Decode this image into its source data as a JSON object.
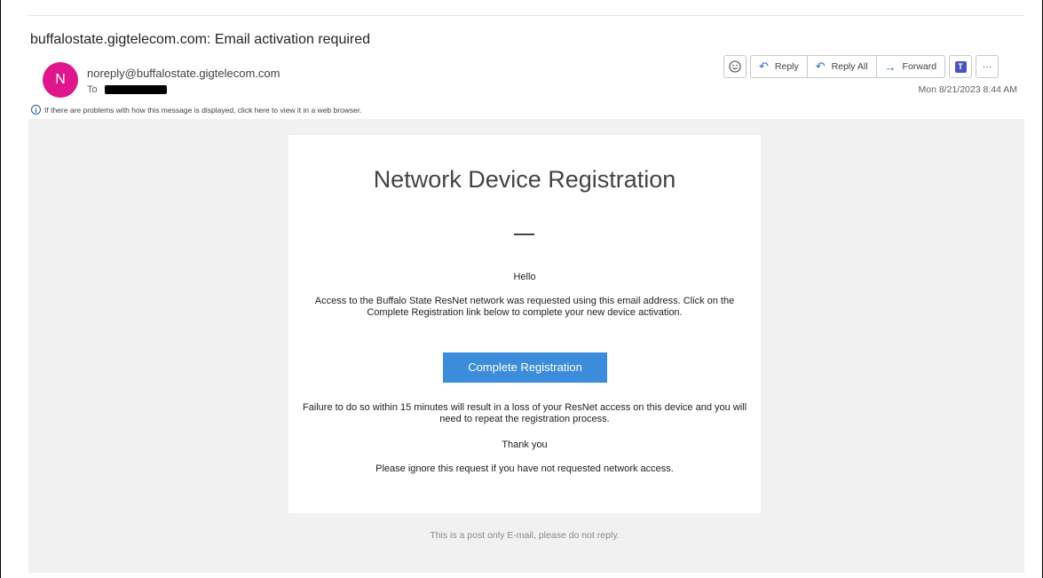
{
  "email": {
    "subject": "buffalostate.gigtelecom.com: Email activation required",
    "avatar_initial": "N",
    "sender": "noreply@buffalostate.gigtelecom.com",
    "to_label": "To",
    "info_text": "If there are problems with how this message is displayed, click here to view it in a web browser.",
    "timestamp": "Mon 8/21/2023 8:44 AM"
  },
  "toolbar": {
    "reply_label": "Reply",
    "reply_all_label": "Reply All",
    "forward_label": "Forward",
    "more_label": "···"
  },
  "message": {
    "heading": "Network Device Registration",
    "greeting": "Hello",
    "access_text": "Access to the Buffalo State ResNet network was requested using this email address. Click on the Complete Registration link below to complete your new device activation.",
    "button_label": "Complete Registration",
    "failure_text": "Failure to do so within 15 minutes will result in a loss of your ResNet access on this device and you will need to repeat the registration process.",
    "thanks_text": "Thank you",
    "ignore_text": "Please ignore this request if you have not requested network access.",
    "footer_text": "This is a post only E-mail, please do not reply."
  },
  "colors": {
    "avatar": "#e0168c",
    "button": "#3b8ddb",
    "body_background": "#f1f1f1",
    "accent": "#2b6cc4"
  }
}
